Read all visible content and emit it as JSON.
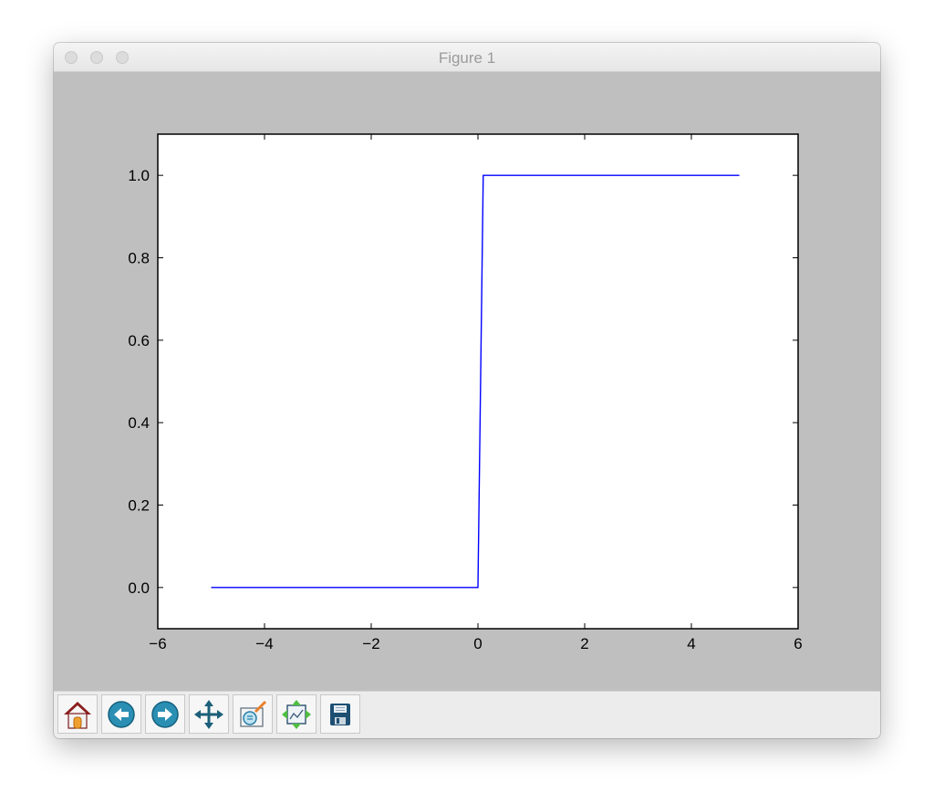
{
  "window": {
    "title": "Figure 1"
  },
  "toolbar": {
    "buttons": [
      {
        "icon": "home-icon",
        "action": "home"
      },
      {
        "icon": "back-icon",
        "action": "back"
      },
      {
        "icon": "forward-icon",
        "action": "forward"
      },
      {
        "icon": "pan-icon",
        "action": "pan"
      },
      {
        "icon": "zoom-to-rect-icon",
        "action": "zoom"
      },
      {
        "icon": "configure-subplots-icon",
        "action": "subplots"
      },
      {
        "icon": "save-icon",
        "action": "save"
      }
    ]
  },
  "colors": {
    "line": "#0000ff",
    "figure_bg": "#bfbfbf",
    "axes_bg": "#ffffff"
  },
  "chart_data": {
    "type": "line",
    "title": "",
    "xlabel": "",
    "ylabel": "",
    "xlim": [
      -6,
      6
    ],
    "ylim": [
      -0.1,
      1.1
    ],
    "xticks": [
      -6,
      -4,
      -2,
      0,
      2,
      4,
      6
    ],
    "xtick_labels": [
      "−6",
      "−4",
      "−2",
      "0",
      "2",
      "4",
      "6"
    ],
    "yticks": [
      0.0,
      0.2,
      0.4,
      0.6,
      0.8,
      1.0
    ],
    "ytick_labels": [
      "0.0",
      "0.2",
      "0.4",
      "0.6",
      "0.8",
      "1.0"
    ],
    "grid": false,
    "series": [
      {
        "x": [
          -5.0,
          -0.1,
          0.0,
          0.1,
          4.9
        ],
        "y": [
          0,
          0,
          0,
          1,
          1
        ]
      }
    ]
  }
}
